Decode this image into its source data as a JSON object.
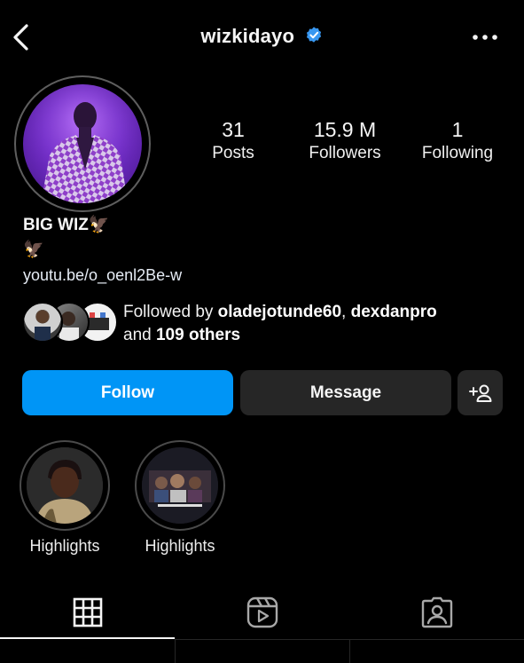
{
  "header": {
    "username": "wizkidayo",
    "accent_color": "#0095f6",
    "icons": [
      "chevron-left-icon",
      "verified-badge-icon",
      "more-options-icon"
    ]
  },
  "stats": {
    "posts": {
      "value": "31",
      "label": "Posts"
    },
    "followers": {
      "value": "15.9 M",
      "label": "Followers"
    },
    "following": {
      "value": "1",
      "label": "Following"
    }
  },
  "bio": {
    "display_name": "BIG WIZ🦅",
    "line2": "🦅",
    "link": "youtu.be/o_oenl2Be-w"
  },
  "followed_by": {
    "prefix": "Followed by",
    "user1": "oladejotunde60",
    "separator": ",",
    "user2": "dexdanpro",
    "and_text": "and",
    "others": "109 others"
  },
  "actions": {
    "follow_label": "Follow",
    "message_label": "Message",
    "follow_color": "#0095f6",
    "secondary_color": "#262626"
  },
  "highlights": [
    {
      "label": "Highlights"
    },
    {
      "label": "Highlights"
    }
  ],
  "tabs": [
    {
      "icon": "grid-icon",
      "active": true
    },
    {
      "icon": "reels-icon",
      "active": false
    },
    {
      "icon": "tagged-icon",
      "active": false
    }
  ]
}
